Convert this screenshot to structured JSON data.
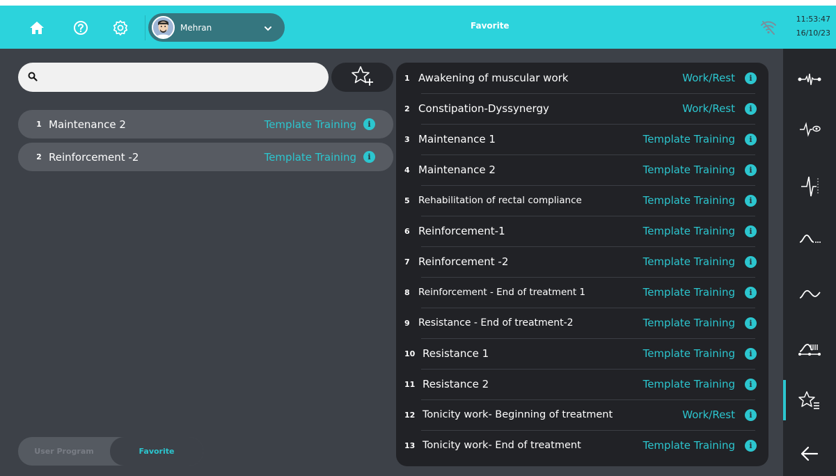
{
  "header": {
    "title": "Favorite",
    "user_name": "Mehran",
    "time": "11:53:47",
    "date": "16/10/23",
    "accent_color": "#2cd3dc"
  },
  "icons": {
    "home": "home-icon",
    "help": "help-icon",
    "settings": "gear-icon",
    "wifi": "wifi-off-icon",
    "search": "search-icon",
    "add_favorite": "star-plus-icon"
  },
  "search": {
    "placeholder": "",
    "value": ""
  },
  "left_list": [
    {
      "num": "1",
      "name": "Maintenance 2",
      "type": "Template Training"
    },
    {
      "num": "2",
      "name": "Reinforcement -2",
      "type": "Template Training"
    }
  ],
  "segments": {
    "user_program": "User Program",
    "favorite": "Favorite",
    "selected": "Favorite"
  },
  "right_list": [
    {
      "num": "1",
      "name": "Awakening of muscular work",
      "type": "Work/Rest"
    },
    {
      "num": "2",
      "name": "Constipation-Dyssynergy",
      "type": "Work/Rest"
    },
    {
      "num": "3",
      "name": "Maintenance 1",
      "type": "Template Training"
    },
    {
      "num": "4",
      "name": "Maintenance 2",
      "type": "Template Training"
    },
    {
      "num": "5",
      "name": "Rehabilitation of rectal compliance",
      "type": "Template Training"
    },
    {
      "num": "6",
      "name": "Reinforcement-1",
      "type": "Template Training"
    },
    {
      "num": "7",
      "name": "Reinforcement -2",
      "type": "Template Training"
    },
    {
      "num": "8",
      "name": "Reinforcement - End of treatment 1",
      "type": "Template Training"
    },
    {
      "num": "9",
      "name": "Resistance - End of treatment-2",
      "type": "Template Training"
    },
    {
      "num": "10",
      "name": "Resistance 1",
      "type": "Template Training"
    },
    {
      "num": "11",
      "name": "Resistance 2",
      "type": "Template Training"
    },
    {
      "num": "12",
      "name": "Tonicity work- Beginning of treatment",
      "type": "Work/Rest"
    },
    {
      "num": "13",
      "name": "Tonicity work- End of treatment",
      "type": "Template Training"
    }
  ],
  "rail": [
    {
      "icon": "signal-emg-icon"
    },
    {
      "icon": "signal-eye-icon"
    },
    {
      "icon": "signal-pulse-icon"
    },
    {
      "icon": "curve-dots-icon"
    },
    {
      "icon": "curve-wave-icon"
    },
    {
      "icon": "curve-bars-icon"
    },
    {
      "icon": "favorite-list-icon",
      "active": true
    },
    {
      "icon": "back-arrow-icon"
    }
  ]
}
